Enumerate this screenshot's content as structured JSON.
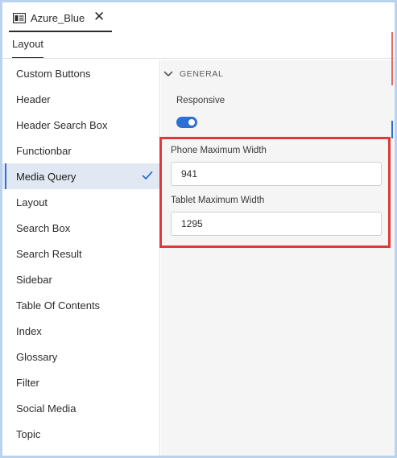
{
  "tab": {
    "title": "Azure_Blue",
    "close_glyph": "✕",
    "icon": "layout-panel-icon"
  },
  "subtab": {
    "label": "Layout"
  },
  "sidebar": {
    "items": [
      {
        "label": "Custom Buttons"
      },
      {
        "label": "Header"
      },
      {
        "label": "Header Search Box"
      },
      {
        "label": "Functionbar"
      },
      {
        "label": "Media Query",
        "active": true
      },
      {
        "label": "Layout"
      },
      {
        "label": "Search Box"
      },
      {
        "label": "Search Result"
      },
      {
        "label": "Sidebar"
      },
      {
        "label": "Table Of Contents"
      },
      {
        "label": "Index"
      },
      {
        "label": "Glossary"
      },
      {
        "label": "Filter"
      },
      {
        "label": "Social Media"
      },
      {
        "label": "Topic"
      }
    ]
  },
  "panel": {
    "section_title": "GENERAL",
    "responsive": {
      "label": "Responsive",
      "enabled": true
    },
    "phone_max_width": {
      "label": "Phone Maximum Width",
      "value": "941"
    },
    "tablet_max_width": {
      "label": "Tablet Maximum Width",
      "value": "1295"
    }
  },
  "colors": {
    "accent": "#2e6fd3",
    "active_bg": "#e1e8f4",
    "highlight": "#e0393a",
    "frame": "#b9d3ee"
  }
}
